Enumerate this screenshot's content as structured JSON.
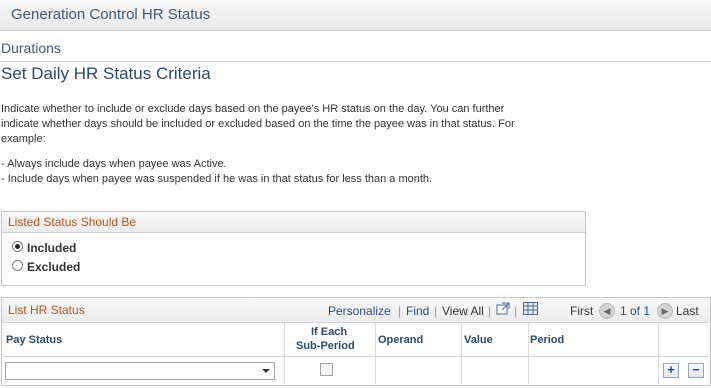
{
  "window": {
    "title": "Generation Control HR Status"
  },
  "section": {
    "title": "Durations"
  },
  "page": {
    "title": "Set Daily HR Status Criteria"
  },
  "instructions": {
    "line1": "Indicate whether to include or exclude days based on the payee's HR status on the day. You can further",
    "line2": "indicate whether days should be included or excluded based on the time the payee was in that status. For",
    "line3": "example:",
    "line4": "- Always include days when payee was Active.",
    "line5": "- Include days when payee was suspended if he was in that status for less than a month."
  },
  "status_group": {
    "title": "Listed Status Should Be",
    "options": [
      {
        "label": "Included",
        "selected": true
      },
      {
        "label": "Excluded",
        "selected": false
      }
    ]
  },
  "grid": {
    "title": "List HR Status",
    "personalize": "Personalize",
    "find": "Find",
    "view_all": "View All",
    "first": "First",
    "range": "1 of 1",
    "last": "Last",
    "columns": {
      "pay_status": "Pay Status",
      "sub_period_line1": "If Each",
      "sub_period_line2": "Sub-Period",
      "operand": "Operand",
      "value": "Value",
      "period": "Period"
    },
    "row": {
      "pay_status": "",
      "sub_period_checked": false
    },
    "add_glyph": "+",
    "delete_glyph": "−"
  },
  "icons": {
    "prev": "previous-arrow-icon",
    "next": "next-arrow-icon",
    "zoom": "new-window-icon",
    "download": "spreadsheet-icon"
  }
}
